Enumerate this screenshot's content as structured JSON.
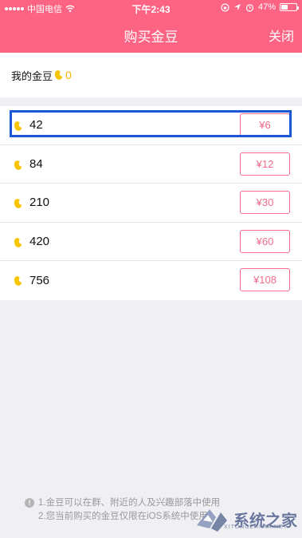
{
  "status_bar": {
    "carrier": "中国电信",
    "time": "下午2:43",
    "battery": "47%",
    "battery_level": 0.47
  },
  "nav": {
    "title": "购买金豆",
    "close_label": "关闭"
  },
  "balance": {
    "label": "我的金豆",
    "value": "0"
  },
  "packages": [
    {
      "amount": "42",
      "price": "¥6"
    },
    {
      "amount": "84",
      "price": "¥12"
    },
    {
      "amount": "210",
      "price": "¥30"
    },
    {
      "amount": "420",
      "price": "¥60"
    },
    {
      "amount": "756",
      "price": "¥108"
    }
  ],
  "notes": [
    "1.金豆可以在群、附近的人及兴趣部落中使用",
    "2.您当前购买的金豆仅限在iOS系统中使用"
  ],
  "watermark": {
    "text": "系统之家",
    "sub": "XITONGZHIJIA.NET"
  },
  "colors": {
    "header": "#fd6383",
    "price_border": "#f26b8a",
    "coin": "#f7c400",
    "selection": "#1a57d6"
  },
  "icons": {
    "coin": "bean-coin-icon",
    "info": "info-icon",
    "wifi": "wifi-icon",
    "battery": "battery-icon"
  }
}
